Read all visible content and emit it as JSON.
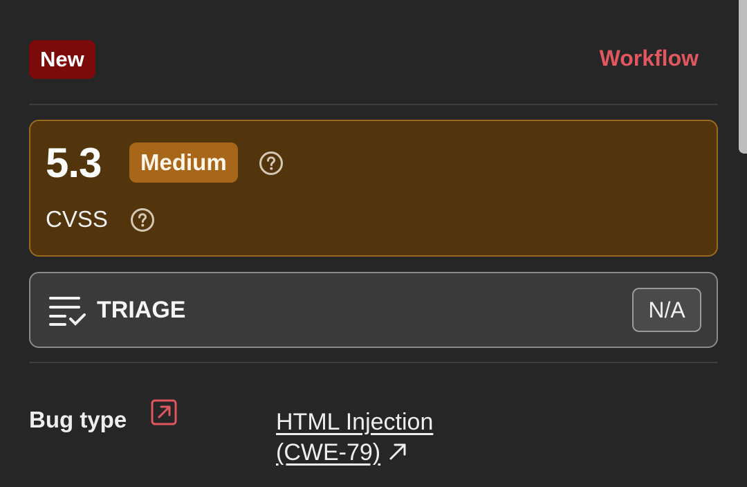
{
  "header": {
    "status_badge": "New",
    "workflow_label": "Workflow"
  },
  "severity": {
    "score": "5.3",
    "level": "Medium",
    "cvss_label": "CVSS"
  },
  "triage": {
    "label": "TRIAGE",
    "value": "N/A"
  },
  "bug_type": {
    "label": "Bug type",
    "value_line1": "HTML Injection",
    "value_line2": "(CWE-79)"
  },
  "colors": {
    "background": "#262626",
    "status_badge": "#7b0b0b",
    "workflow": "#e0575f",
    "severity_card": "#53350d",
    "severity_badge": "#a8661b",
    "triage_card": "#3a3a3a"
  },
  "icons": {
    "help": "question-circle-icon",
    "triage": "list-check-icon",
    "external": "external-link-icon",
    "arrow": "arrow-up-right-icon"
  }
}
